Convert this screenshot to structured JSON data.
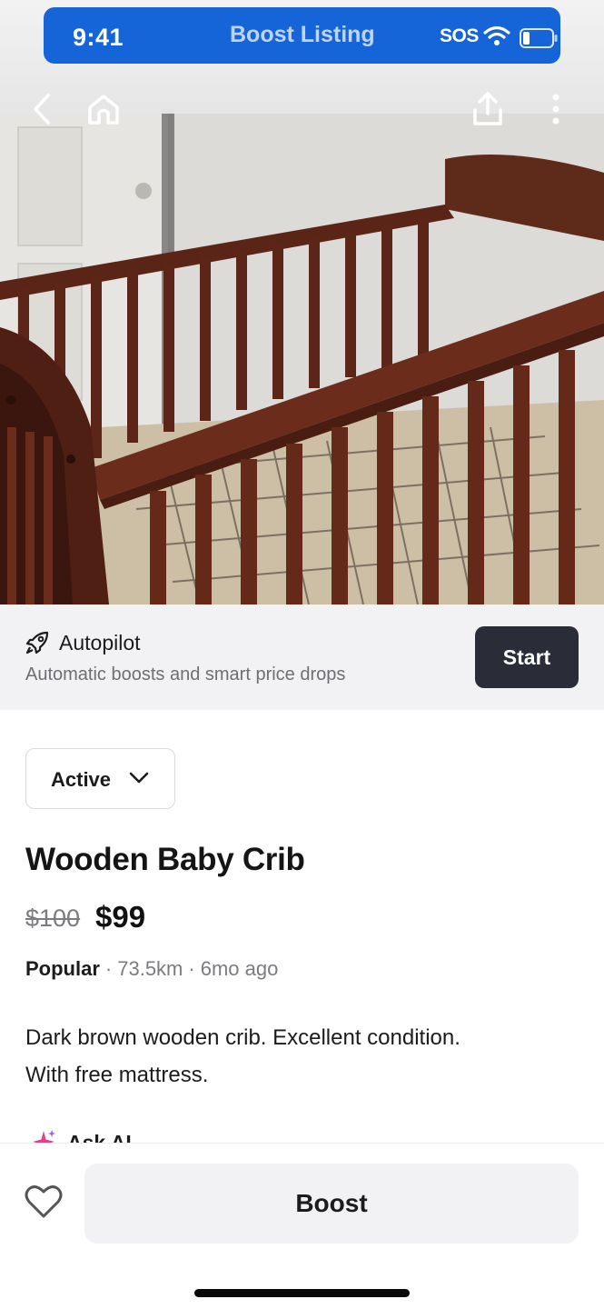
{
  "status_bar": {
    "time": "9:41",
    "title": "Boost Listing",
    "sos": "SOS",
    "accent": "#1565d8"
  },
  "nav": {
    "back_icon": "chevron-left-icon",
    "home_icon": "home-icon",
    "share_icon": "share-icon",
    "more_icon": "more-vertical-icon"
  },
  "autopilot": {
    "icon": "rocket-icon",
    "title": "Autopilot",
    "subtitle": "Automatic boosts and smart price drops",
    "start_label": "Start"
  },
  "listing": {
    "status_label": "Active",
    "title": "Wooden Baby Crib",
    "old_price": "$100",
    "price": "$99",
    "tag": "Popular",
    "distance": "73.5km",
    "age": "6mo ago",
    "description_lines": [
      "Dark brown wooden crib.  Excellent condition.",
      "With free mattress."
    ],
    "ask_ai_label": "Ask AI"
  },
  "bottom": {
    "favorite_icon": "heart-icon",
    "boost_label": "Boost"
  }
}
